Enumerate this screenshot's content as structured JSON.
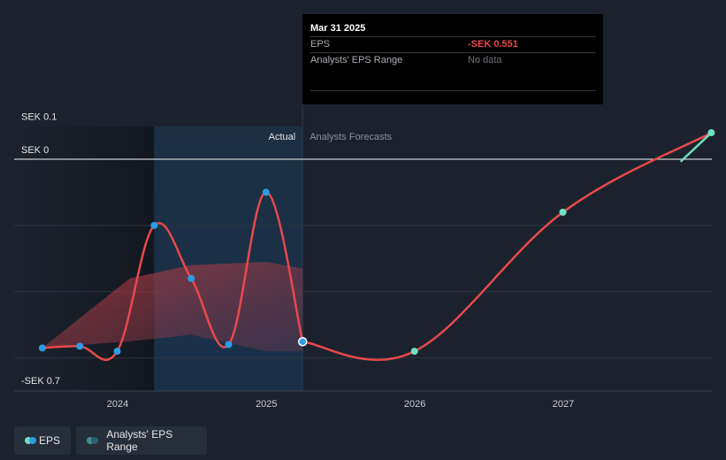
{
  "tooltip": {
    "date": "Mar 31 2025",
    "eps_label": "EPS",
    "eps_value": "-SEK 0.551",
    "range_label": "Analysts' EPS Range",
    "range_value": "No data"
  },
  "regions": {
    "actual_label": "Actual",
    "forecast_label": "Analysts Forecasts"
  },
  "legend": {
    "eps_label": "EPS",
    "range_label": "Analysts' EPS Range"
  },
  "colors": {
    "background": "#1b222d",
    "eps_line": "#e8484b",
    "eps_point": "#2e9be6",
    "forecast_point": "#6fe0c4",
    "range_fill": "#b23a3f",
    "actual_band": "#1c3a55"
  },
  "chart_data": {
    "type": "line",
    "y_unit": "SEK",
    "y_tick_labels": [
      "SEK 0.1",
      "SEK 0",
      "-SEK 0.7"
    ],
    "x_tick_labels": [
      "2024",
      "2025",
      "2026",
      "2027"
    ],
    "xlim": [
      "2023-07-01",
      "2027-12-31"
    ],
    "ylim": [
      -0.7,
      0.1
    ],
    "series": [
      {
        "name": "EPS",
        "kind": "actual",
        "points": [
          {
            "x": "2023-06-30",
            "y": -0.57
          },
          {
            "x": "2023-09-30",
            "y": -0.565
          },
          {
            "x": "2023-12-31",
            "y": -0.58
          },
          {
            "x": "2024-03-31",
            "y": -0.2
          },
          {
            "x": "2024-06-30",
            "y": -0.36
          },
          {
            "x": "2024-09-30",
            "y": -0.56
          },
          {
            "x": "2024-12-31",
            "y": -0.1
          },
          {
            "x": "2025-03-31",
            "y": -0.551
          }
        ]
      },
      {
        "name": "EPS",
        "kind": "forecast",
        "points": [
          {
            "x": "2025-03-31",
            "y": -0.551
          },
          {
            "x": "2025-12-31",
            "y": -0.58
          },
          {
            "x": "2026-12-31",
            "y": -0.16
          },
          {
            "x": "2027-12-31",
            "y": 0.08
          }
        ]
      }
    ],
    "range_band": {
      "upper": [
        {
          "x": "2023-06-30",
          "y": -0.57
        },
        {
          "x": "2024-01-31",
          "y": -0.36
        },
        {
          "x": "2024-06-30",
          "y": -0.32
        },
        {
          "x": "2024-12-31",
          "y": -0.31
        },
        {
          "x": "2025-03-31",
          "y": -0.33
        }
      ],
      "lower": [
        {
          "x": "2025-03-31",
          "y": -0.58
        },
        {
          "x": "2024-12-31",
          "y": -0.58
        },
        {
          "x": "2024-06-30",
          "y": -0.53
        },
        {
          "x": "2024-01-31",
          "y": -0.55
        },
        {
          "x": "2023-06-30",
          "y": -0.57
        }
      ]
    }
  }
}
